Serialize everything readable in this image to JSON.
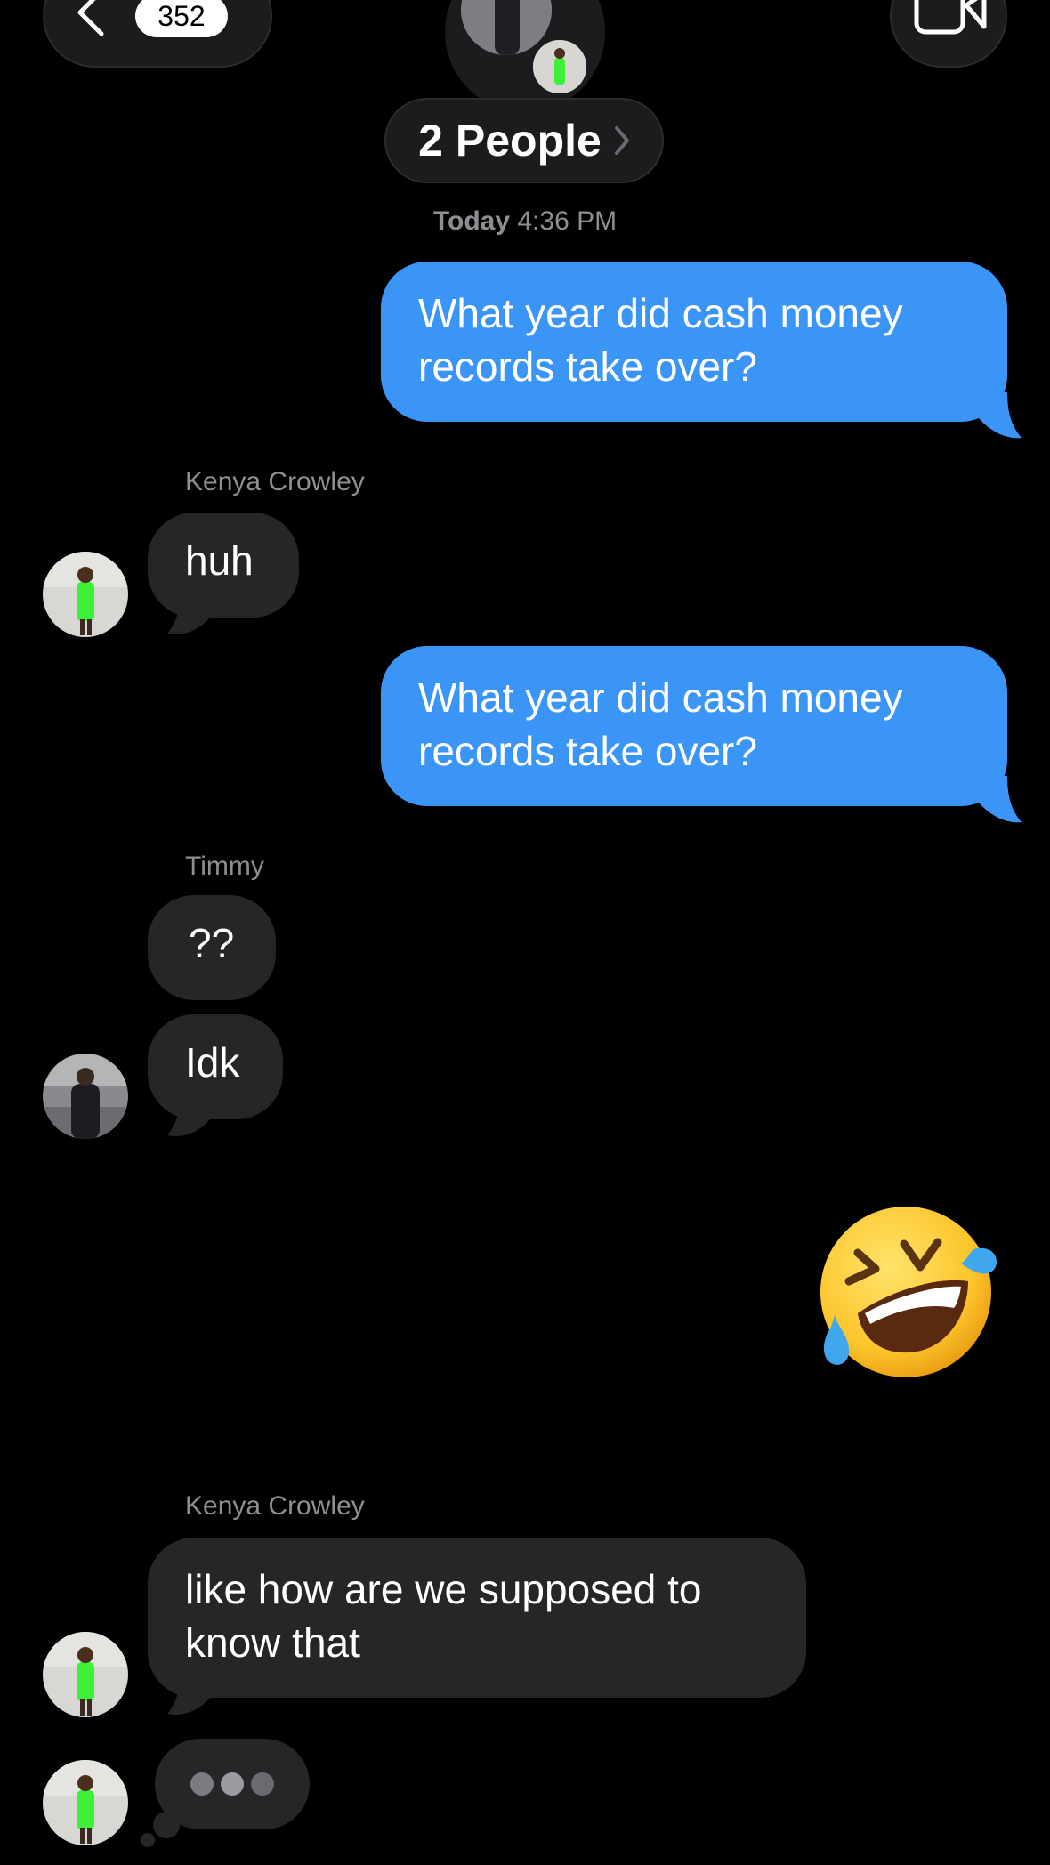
{
  "header": {
    "back_count": "352",
    "group_label": "2 People",
    "back_icon": "chevron-left-icon",
    "video_icon": "video-camera-icon"
  },
  "timestamp": {
    "day": "Today",
    "time": "4:36 PM"
  },
  "messages": [
    {
      "kind": "outgoing",
      "text_lines": [
        "What year did cash money",
        "records take over?"
      ]
    },
    {
      "kind": "incoming",
      "sender": "Kenya Crowley",
      "text": "huh"
    },
    {
      "kind": "outgoing",
      "text_lines": [
        "What year did cash money",
        "records take over?"
      ]
    },
    {
      "kind": "incoming",
      "sender": "Timmy",
      "text": "??"
    },
    {
      "kind": "incoming",
      "text": "Idk"
    },
    {
      "kind": "outgoing-emoji",
      "emoji": "rolling-on-the-floor-laughing"
    },
    {
      "kind": "incoming",
      "sender": "Kenya Crowley",
      "text_lines": [
        "like how are we supposed to",
        "know that"
      ]
    },
    {
      "kind": "typing-indicator"
    }
  ],
  "colors": {
    "outgoing_bubble": "#3a95f6",
    "incoming_bubble": "#262628",
    "background": "#000000",
    "meta_text": "#8e8e93"
  }
}
